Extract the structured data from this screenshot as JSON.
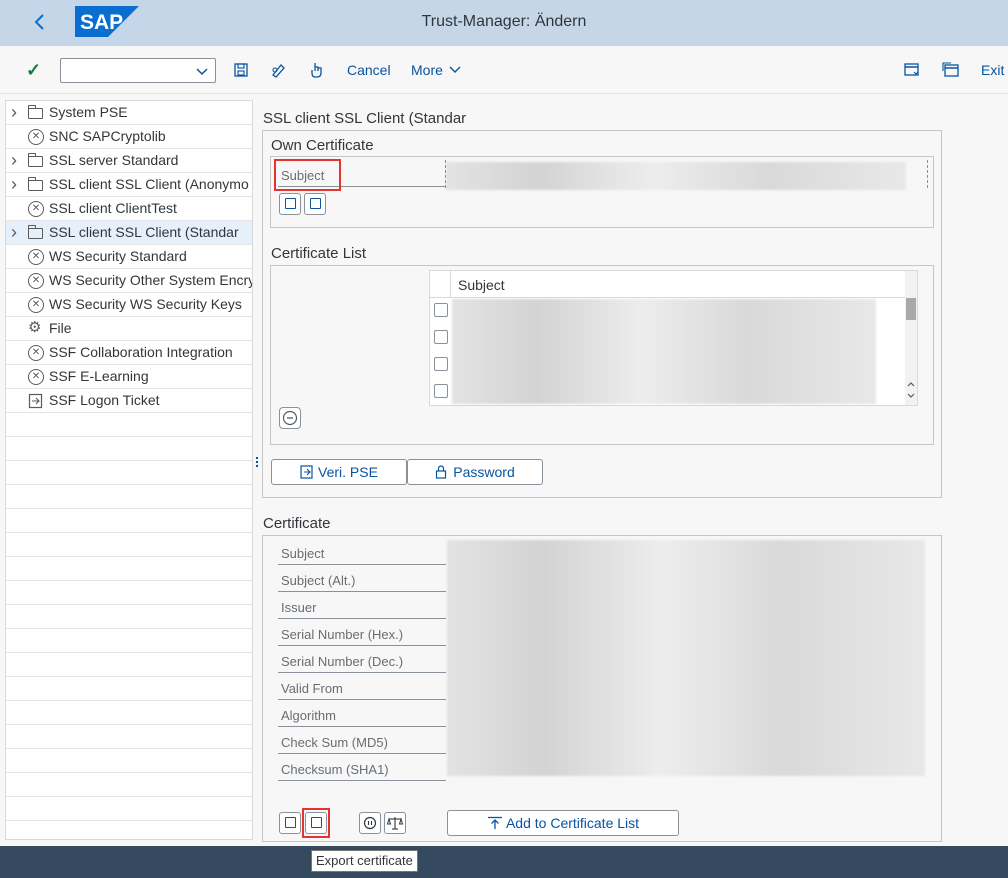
{
  "shell": {
    "title": "Trust-Manager: Ändern",
    "logo_text": "SAP"
  },
  "toolbar": {
    "cancel_label": "Cancel",
    "more_label": "More",
    "exit_label": "Exit",
    "command_value": ""
  },
  "tree": {
    "items": [
      {
        "label": "System PSE",
        "icon": "folder-icon",
        "expandable": true
      },
      {
        "label": "SNC SAPCryptolib",
        "icon": "error-circle-icon",
        "expandable": false
      },
      {
        "label": "SSL server Standard",
        "icon": "folder-icon",
        "expandable": true
      },
      {
        "label": "SSL client SSL Client (Anonymo",
        "icon": "folder-icon",
        "expandable": true
      },
      {
        "label": "SSL client ClientTest",
        "icon": "error-circle-icon",
        "expandable": false
      },
      {
        "label": "SSL client SSL Client (Standar",
        "icon": "folder-icon",
        "expandable": true,
        "selected": true
      },
      {
        "label": "WS Security Standard",
        "icon": "error-circle-icon",
        "expandable": false
      },
      {
        "label": "WS Security Other System Encry",
        "icon": "error-circle-icon",
        "expandable": false
      },
      {
        "label": "WS Security WS Security Keys",
        "icon": "error-circle-icon",
        "expandable": false
      },
      {
        "label": "File",
        "icon": "gear-icon",
        "expandable": false
      },
      {
        "label": "SSF Collaboration Integration",
        "icon": "error-circle-icon",
        "expandable": false
      },
      {
        "label": "SSF E-Learning",
        "icon": "error-circle-icon",
        "expandable": false
      },
      {
        "label": "SSF Logon Ticket",
        "icon": "export-icon",
        "expandable": false
      }
    ]
  },
  "main": {
    "pse_title": "SSL client SSL Client (Standar",
    "own_cert": {
      "title": "Own Certificate",
      "subject_label": "Subject"
    },
    "cert_list": {
      "title": "Certificate List",
      "column_subject": "Subject"
    },
    "buttons": {
      "veri_pse": "Veri. PSE",
      "password": "Password",
      "add_to_list": "Add to Certificate List"
    },
    "certificate": {
      "title": "Certificate",
      "fields": [
        "Subject",
        "Subject (Alt.)",
        "Issuer",
        "Serial Number (Hex.)",
        "Serial Number (Dec.)",
        "Valid From",
        "Algorithm",
        "Check Sum (MD5)",
        "Checksum (SHA1)"
      ]
    }
  },
  "tooltip": {
    "text": "Export certificate"
  },
  "colors": {
    "shell_bg": "#c5d6e8",
    "accent": "#0854a0",
    "highlight": "#e3342f",
    "status_bar": "#354a5f"
  }
}
